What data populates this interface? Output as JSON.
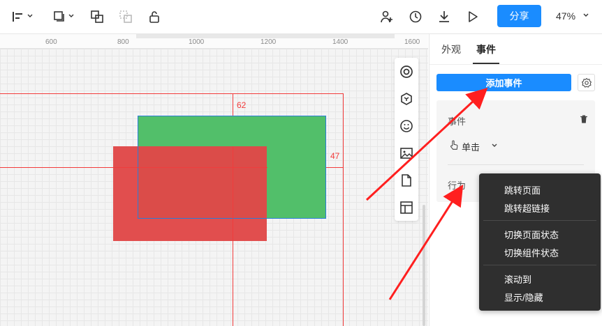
{
  "toolbar": {
    "share_label": "分享",
    "zoom_label": "47%"
  },
  "ruler": {
    "ticks": [
      "600",
      "800",
      "1000",
      "1200",
      "1400",
      "1600"
    ]
  },
  "canvas": {
    "measure_top": "62",
    "measure_right": "47"
  },
  "panel": {
    "tabs": [
      "外观",
      "事件"
    ],
    "active_tab": "事件",
    "add_event_label": "添加事件",
    "event_title": "事件",
    "trigger_label": "单击",
    "action_label": "行为"
  },
  "dropdown": {
    "items": [
      "跳转页面",
      "跳转超链接",
      "切换页面状态",
      "切换组件状态",
      "滚动到",
      "显示/隐藏"
    ]
  },
  "colors": {
    "accent": "#1a8cff",
    "guide": "#f23b3b",
    "green_shape": "#52bf6a",
    "red_shape": "#e04848",
    "annotation_arrow": "#ff1f1f"
  }
}
